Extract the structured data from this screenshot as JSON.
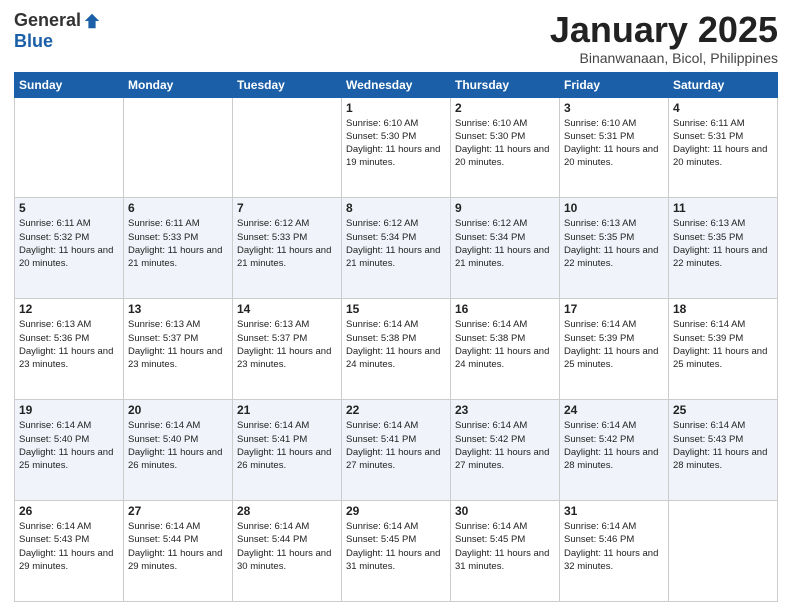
{
  "logo": {
    "general": "General",
    "blue": "Blue"
  },
  "title": "January 2025",
  "location": "Binanwanaan, Bicol, Philippines",
  "days_of_week": [
    "Sunday",
    "Monday",
    "Tuesday",
    "Wednesday",
    "Thursday",
    "Friday",
    "Saturday"
  ],
  "weeks": [
    [
      {
        "day": "",
        "info": ""
      },
      {
        "day": "",
        "info": ""
      },
      {
        "day": "",
        "info": ""
      },
      {
        "day": "1",
        "info": "Sunrise: 6:10 AM\nSunset: 5:30 PM\nDaylight: 11 hours and 19 minutes."
      },
      {
        "day": "2",
        "info": "Sunrise: 6:10 AM\nSunset: 5:30 PM\nDaylight: 11 hours and 20 minutes."
      },
      {
        "day": "3",
        "info": "Sunrise: 6:10 AM\nSunset: 5:31 PM\nDaylight: 11 hours and 20 minutes."
      },
      {
        "day": "4",
        "info": "Sunrise: 6:11 AM\nSunset: 5:31 PM\nDaylight: 11 hours and 20 minutes."
      }
    ],
    [
      {
        "day": "5",
        "info": "Sunrise: 6:11 AM\nSunset: 5:32 PM\nDaylight: 11 hours and 20 minutes."
      },
      {
        "day": "6",
        "info": "Sunrise: 6:11 AM\nSunset: 5:33 PM\nDaylight: 11 hours and 21 minutes."
      },
      {
        "day": "7",
        "info": "Sunrise: 6:12 AM\nSunset: 5:33 PM\nDaylight: 11 hours and 21 minutes."
      },
      {
        "day": "8",
        "info": "Sunrise: 6:12 AM\nSunset: 5:34 PM\nDaylight: 11 hours and 21 minutes."
      },
      {
        "day": "9",
        "info": "Sunrise: 6:12 AM\nSunset: 5:34 PM\nDaylight: 11 hours and 21 minutes."
      },
      {
        "day": "10",
        "info": "Sunrise: 6:13 AM\nSunset: 5:35 PM\nDaylight: 11 hours and 22 minutes."
      },
      {
        "day": "11",
        "info": "Sunrise: 6:13 AM\nSunset: 5:35 PM\nDaylight: 11 hours and 22 minutes."
      }
    ],
    [
      {
        "day": "12",
        "info": "Sunrise: 6:13 AM\nSunset: 5:36 PM\nDaylight: 11 hours and 23 minutes."
      },
      {
        "day": "13",
        "info": "Sunrise: 6:13 AM\nSunset: 5:37 PM\nDaylight: 11 hours and 23 minutes."
      },
      {
        "day": "14",
        "info": "Sunrise: 6:13 AM\nSunset: 5:37 PM\nDaylight: 11 hours and 23 minutes."
      },
      {
        "day": "15",
        "info": "Sunrise: 6:14 AM\nSunset: 5:38 PM\nDaylight: 11 hours and 24 minutes."
      },
      {
        "day": "16",
        "info": "Sunrise: 6:14 AM\nSunset: 5:38 PM\nDaylight: 11 hours and 24 minutes."
      },
      {
        "day": "17",
        "info": "Sunrise: 6:14 AM\nSunset: 5:39 PM\nDaylight: 11 hours and 25 minutes."
      },
      {
        "day": "18",
        "info": "Sunrise: 6:14 AM\nSunset: 5:39 PM\nDaylight: 11 hours and 25 minutes."
      }
    ],
    [
      {
        "day": "19",
        "info": "Sunrise: 6:14 AM\nSunset: 5:40 PM\nDaylight: 11 hours and 25 minutes."
      },
      {
        "day": "20",
        "info": "Sunrise: 6:14 AM\nSunset: 5:40 PM\nDaylight: 11 hours and 26 minutes."
      },
      {
        "day": "21",
        "info": "Sunrise: 6:14 AM\nSunset: 5:41 PM\nDaylight: 11 hours and 26 minutes."
      },
      {
        "day": "22",
        "info": "Sunrise: 6:14 AM\nSunset: 5:41 PM\nDaylight: 11 hours and 27 minutes."
      },
      {
        "day": "23",
        "info": "Sunrise: 6:14 AM\nSunset: 5:42 PM\nDaylight: 11 hours and 27 minutes."
      },
      {
        "day": "24",
        "info": "Sunrise: 6:14 AM\nSunset: 5:42 PM\nDaylight: 11 hours and 28 minutes."
      },
      {
        "day": "25",
        "info": "Sunrise: 6:14 AM\nSunset: 5:43 PM\nDaylight: 11 hours and 28 minutes."
      }
    ],
    [
      {
        "day": "26",
        "info": "Sunrise: 6:14 AM\nSunset: 5:43 PM\nDaylight: 11 hours and 29 minutes."
      },
      {
        "day": "27",
        "info": "Sunrise: 6:14 AM\nSunset: 5:44 PM\nDaylight: 11 hours and 29 minutes."
      },
      {
        "day": "28",
        "info": "Sunrise: 6:14 AM\nSunset: 5:44 PM\nDaylight: 11 hours and 30 minutes."
      },
      {
        "day": "29",
        "info": "Sunrise: 6:14 AM\nSunset: 5:45 PM\nDaylight: 11 hours and 31 minutes."
      },
      {
        "day": "30",
        "info": "Sunrise: 6:14 AM\nSunset: 5:45 PM\nDaylight: 11 hours and 31 minutes."
      },
      {
        "day": "31",
        "info": "Sunrise: 6:14 AM\nSunset: 5:46 PM\nDaylight: 11 hours and 32 minutes."
      },
      {
        "day": "",
        "info": ""
      }
    ]
  ]
}
